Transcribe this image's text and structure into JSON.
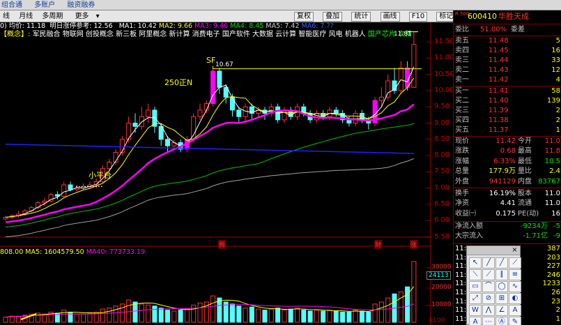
{
  "top_bar": {
    "items": [
      "组合通",
      "多账户",
      "融资融券"
    ]
  },
  "period_bar": {
    "items": [
      "线",
      "月线",
      "多周期",
      "更多"
    ],
    "buttons": [
      "复权",
      "叠加",
      "统计",
      "画线",
      "F10",
      "标记",
      "自选",
      "返回"
    ]
  },
  "legend": {
    "avg": "0) 均价: 11.18",
    "limit": "明日涨停参考: 12.56",
    "ma1": "MA1: 10.42",
    "ma2": "MA2: 9.66",
    "ma3": "MA3: 9.46",
    "ma4": "MA4: 8.45",
    "ma5": "MA5: 7.42",
    "ma6": "MA6: 7.??"
  },
  "concept": {
    "tag": "【概念】:",
    "text": "军民融合 物联网 创投概念 新三板 阿里概念 新计算 消费电子 国产软件 大数据 云计算 智能医疗 风电 机器人",
    "green": "国产芯片 次新股 近期异动"
  },
  "annotations": {
    "sf": "SF",
    "sf_value": "10.67",
    "pos250": "250正N",
    "small_platform": "小平台",
    "high": "11.81"
  },
  "price_axis": [
    "11.50",
    "11.00",
    "10.50",
    "10.00",
    "9.50",
    "9.00",
    "8.50",
    "8.00",
    "7.50",
    "7.00",
    "6.50",
    "6.00",
    "5.50"
  ],
  "markers": {
    "m1": "腾",
    "m2": "财",
    "m3": "涨"
  },
  "volume_legend": {
    "vol": "808.00",
    "ma5": "MA5: 1604579.50",
    "ma40": "MA40: 773733.19"
  },
  "volume_axis": [
    "30000",
    "20000",
    "10000"
  ],
  "volume_current": "24113",
  "volume_unit": "X100",
  "quote": {
    "code_badge": "R 500",
    "code": "600410",
    "name": "华胜天成",
    "weibi_label": "委比",
    "weibi": "51.00%",
    "weicha_label": "委差",
    "weicha": "",
    "sells": [
      {
        "label": "卖五",
        "price": "11.48",
        "vol": "5"
      },
      {
        "label": "卖四",
        "price": "11.45",
        "vol": "16"
      },
      {
        "label": "卖三",
        "price": "11.44",
        "vol": "33"
      },
      {
        "label": "卖二",
        "price": "11.43",
        "vol": "12"
      },
      {
        "label": "卖一",
        "price": "11.42",
        "vol": "4"
      }
    ],
    "buys": [
      {
        "label": "买一",
        "price": "11.41",
        "vol": "58"
      },
      {
        "label": "买二",
        "price": "11.40",
        "vol": "139"
      },
      {
        "label": "买三",
        "price": "11.39",
        "vol": "2"
      },
      {
        "label": "买四",
        "price": "11.38",
        "vol": "2"
      },
      {
        "label": "买五",
        "price": "11.37",
        "vol": "1"
      }
    ],
    "stats": [
      {
        "l1": "现价",
        "v1": "11.42",
        "c1": "red",
        "l2": "今开",
        "v2": "11.0",
        "c2": "red"
      },
      {
        "l1": "涨跌",
        "v1": "0.68",
        "c1": "red",
        "l2": "最高",
        "v2": "11.8",
        "c2": "red"
      },
      {
        "l1": "涨幅",
        "v1": "6.33%",
        "c1": "red",
        "l2": "最低",
        "v2": "10.5",
        "c2": "grn"
      },
      {
        "l1": "总量",
        "v1": "177.9万",
        "c1": "yel",
        "l2": "量比",
        "v2": "2.4",
        "c2": "yel"
      },
      {
        "l1": "外盘",
        "v1": "941129",
        "c1": "red",
        "l2": "内盘",
        "v2": "83767",
        "c2": "grn"
      }
    ],
    "stats2": [
      {
        "l1": "换手",
        "v1": "16.19%",
        "c1": "wht",
        "l2": "股本",
        "v2": "11.0",
        "c2": "wht"
      },
      {
        "l1": "净资",
        "v1": "4.41",
        "c1": "wht",
        "l2": "流通",
        "v2": "11.0",
        "c2": "wht"
      },
      {
        "l1": "收益㈠",
        "v1": "0.175",
        "c1": "wht",
        "l2": "PE(动)",
        "v2": "16",
        "c2": "wht"
      }
    ],
    "flow": [
      {
        "l": "净流入额",
        "v": "-9234万",
        "v2": "-5"
      },
      {
        "l": "大宗流入",
        "v": "-1.71亿",
        "v2": "-9"
      }
    ],
    "ticks": [
      {
        "t": "11:29",
        "p": "11.48",
        "v": "387"
      },
      {
        "t": "11:29",
        "p": "",
        "v": "203"
      },
      {
        "t": "11:29",
        "p": "",
        "v": "227"
      },
      {
        "t": "11:29",
        "p": "",
        "v": "246"
      },
      {
        "t": "11:29",
        "p": "",
        "v": "1233"
      },
      {
        "t": "11:29",
        "p": "",
        "v": "26"
      },
      {
        "t": "11:29",
        "p": "",
        "v": "23"
      },
      {
        "t": "11:29",
        "p": "",
        "v": "2"
      },
      {
        "t": "11:29",
        "p": "",
        "v": "1"
      }
    ]
  },
  "colors": {
    "up": "#ff3232",
    "down": "#54ffff",
    "ma1": "#ffffff",
    "ma2": "#ffff00",
    "ma3": "#ff00ff",
    "ma4": "#00c000",
    "ma5": "#a0a0a0",
    "ma6": "#0000ff"
  }
}
